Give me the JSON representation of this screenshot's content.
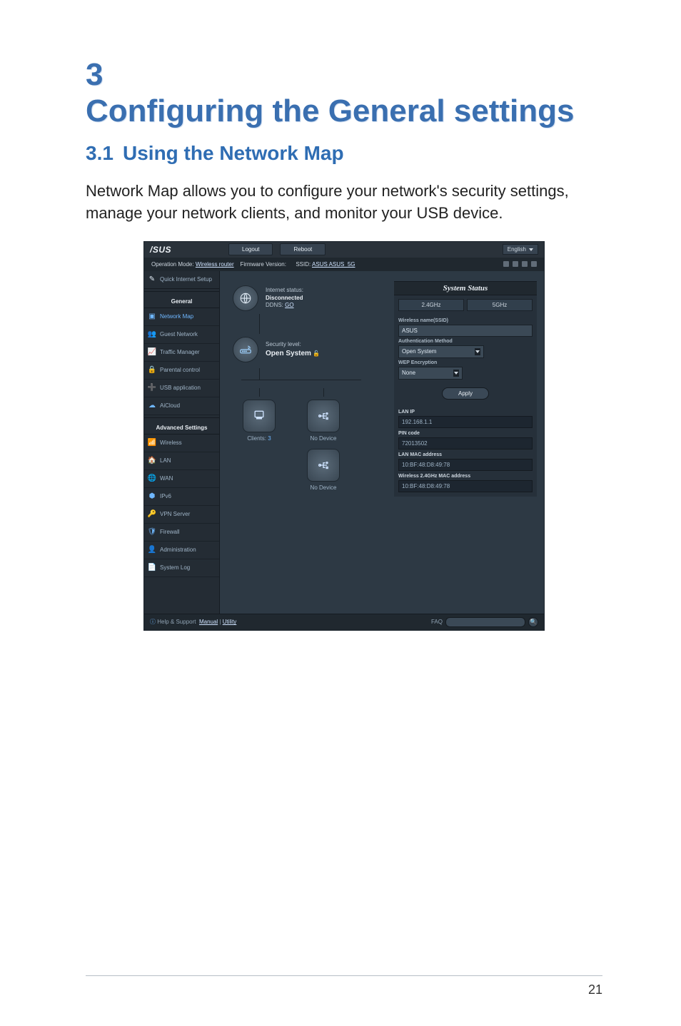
{
  "doc": {
    "chapter_number": "3",
    "chapter_title": "Configuring the General settings",
    "section_number": "3.1",
    "section_title": "Using the Network Map",
    "body": "Network Map allows you to configure your network's security settings, manage your network clients, and monitor your USB device.",
    "page_number": "21"
  },
  "ui": {
    "brand": "/SUS",
    "logout": "Logout",
    "reboot": "Reboot",
    "language": "English",
    "opmode_label": "Operation Mode:",
    "opmode_value": "Wireless router",
    "fw_label": "Firmware Version:",
    "ssid_label": "SSID:",
    "ssid_values": "ASUS  ASUS_5G",
    "quick_setup": "Quick Internet Setup",
    "general_header": "General",
    "nav_general": [
      "Network Map",
      "Guest Network",
      "Traffic Manager",
      "Parental control",
      "USB application",
      "AiCloud"
    ],
    "advanced_header": "Advanced Settings",
    "nav_advanced": [
      "Wireless",
      "LAN",
      "WAN",
      "IPv6",
      "VPN Server",
      "Firewall",
      "Administration",
      "System Log"
    ],
    "node_internet_label": "Internet status:",
    "node_internet_value": "Disconnected",
    "node_ddns_label": "DDNS:",
    "node_ddns_value": "GO",
    "node_security_label": "Security level:",
    "node_security_value": "Open System",
    "clients_label": "Clients:",
    "clients_value": "3",
    "no_device": "No Device",
    "status_title": "System Status",
    "band24": "2.4GHz",
    "band5": "5GHz",
    "ssid_field_label": "Wireless name(SSID)",
    "ssid_field_value": "ASUS",
    "auth_label": "Authentication Method",
    "auth_value": "Open System",
    "wep_label": "WEP Encryption",
    "wep_value": "None",
    "apply": "Apply",
    "lan_ip_label": "LAN IP",
    "lan_ip_value": "192.168.1.1",
    "pin_label": "PIN code",
    "pin_value": "72013502",
    "lan_mac_label": "LAN MAC address",
    "lan_mac_value": "10:BF:48:D8:49:78",
    "wmac_label": "Wireless 2.4GHz MAC address",
    "wmac_value": "10:BF:48:D8:49:78",
    "help_text": "Help & Support",
    "manual_text": "Manual",
    "utility_text": "Utility",
    "faq_label": "FAQ"
  }
}
